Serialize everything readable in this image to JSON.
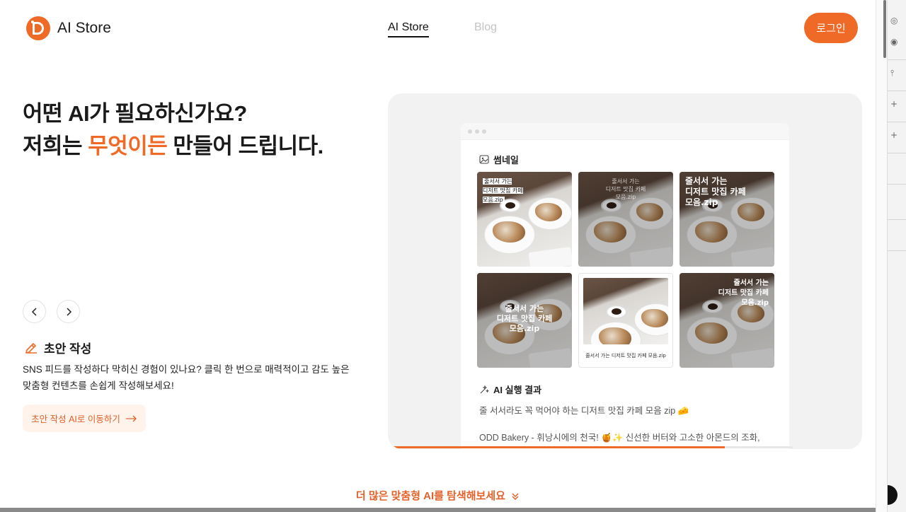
{
  "header": {
    "logo_text": "AI Store",
    "nav": [
      {
        "label": "AI Store",
        "active": true
      },
      {
        "label": "Blog",
        "active": false
      }
    ],
    "login_label": "로그인"
  },
  "hero": {
    "line1": "어떤 AI가 필요하신가요?",
    "line2_prefix": "저희는 ",
    "line2_accent": "무엇이든",
    "line2_suffix": " 만들어 드립니다."
  },
  "feature": {
    "icon": "pencil-icon",
    "title": "초안 작성",
    "description_line1": "SNS 피드를 작성하다 막히신 경험이 있나요? 클릭 한 번으로 매력적이고 감도 높은",
    "description_line2": "맞춤형 컨텐츠를 손쉽게 작성해보세요!",
    "cta_label": "초안 작성 AI로 이동하기"
  },
  "preview": {
    "thumbnail_heading": "썸네일",
    "thumbnails": [
      {
        "caption": "줄서서 가는\n디저트 맛집 카페\n모음.zip",
        "style": "label-top-left"
      },
      {
        "caption": "줄서서 가는\n디저트 맛집 카페\n모음.zip",
        "style": "faded-top"
      },
      {
        "caption": "줄서서 가는\n디저트 맛집 카페\n모음.zip",
        "style": "bold-top-left"
      },
      {
        "caption": "줄서서 가는\n디저트 맛집 카페\n모음.zip",
        "style": "bold-center"
      },
      {
        "caption": "줄서서 가는 디저트 맛집 카페 모음.zip",
        "style": "framed"
      },
      {
        "caption": "줄서서 가는\n디저트 맛집 카페\n모음.zip",
        "style": "bold-top-right"
      }
    ],
    "result_heading": "AI 실행 결과",
    "result_line1": "줄 서서라도 꼭 먹어야 하는 디저트 맛집 카페 모음 zip 🧀",
    "result_line2": "ODD Bakery - 휘낭시에의 천국! 🍯✨ 신선한 버터와 고소한 아몬드의 조화,",
    "progress": 0.83
  },
  "explore_label": "더 많은 맞춤형 AI를 탐색해보세요",
  "colors": {
    "accent": "#ef6a26"
  }
}
